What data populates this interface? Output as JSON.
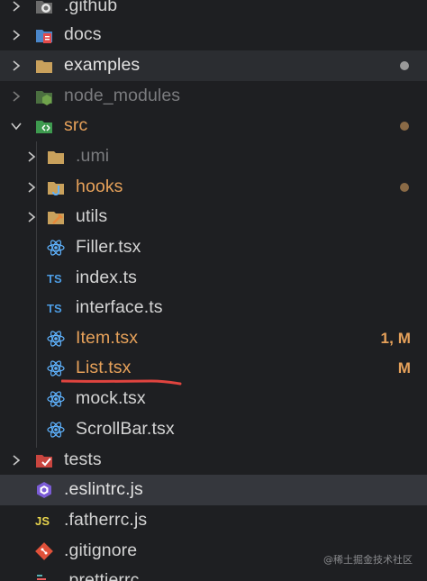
{
  "explorer": {
    "items": [
      {
        "label": ".github",
        "icon": "github-folder-icon",
        "color": "#d4d4d4"
      },
      {
        "label": "docs",
        "icon": "docs-folder-icon",
        "color": "#d4d4d4"
      },
      {
        "label": "examples",
        "icon": "folder-icon",
        "color": "#e2e2e2"
      },
      {
        "label": "node_modules",
        "icon": "node-folder-icon",
        "color": "#7a7b7e"
      },
      {
        "label": "src",
        "icon": "src-folder-icon",
        "color": "#e6a15a"
      },
      {
        "label": ".umi",
        "icon": "folder-icon",
        "color": "#7a7b7e"
      },
      {
        "label": "hooks",
        "icon": "hooks-folder-icon",
        "color": "#e6a15a"
      },
      {
        "label": "utils",
        "icon": "utils-folder-icon",
        "color": "#d4d4d4"
      },
      {
        "label": "Filler.tsx",
        "icon": "react-icon",
        "color": "#d4d4d4"
      },
      {
        "label": "index.ts",
        "icon": "typescript-icon",
        "color": "#d4d4d4"
      },
      {
        "label": "interface.ts",
        "icon": "typescript-icon",
        "color": "#d4d4d4"
      },
      {
        "label": "Item.tsx",
        "icon": "react-icon",
        "color": "#e6a15a"
      },
      {
        "label": "List.tsx",
        "icon": "react-icon",
        "color": "#e6a15a"
      },
      {
        "label": "mock.tsx",
        "icon": "react-icon",
        "color": "#d4d4d4"
      },
      {
        "label": "ScrollBar.tsx",
        "icon": "react-icon",
        "color": "#d4d4d4"
      },
      {
        "label": "tests",
        "icon": "tests-folder-icon",
        "color": "#d4d4d4"
      },
      {
        "label": ".eslintrc.js",
        "icon": "eslint-icon",
        "color": "#e2e2e2"
      },
      {
        "label": ".fatherrc.js",
        "icon": "javascript-icon",
        "color": "#d4d4d4"
      },
      {
        "label": ".gitignore",
        "icon": "git-icon",
        "color": "#d4d4d4"
      },
      {
        "label": ".prettierrc",
        "icon": "prettier-icon",
        "color": "#d4d4d4"
      }
    ],
    "status": {
      "item": "1, M",
      "list": "M"
    }
  },
  "watermark": "@稀土掘金技术社区",
  "colors": {
    "background": "#1e1f22",
    "highlight": "#2b2d31",
    "selected": "#35373d",
    "modified": "#e6a15a",
    "underline": "#e0443f",
    "react": "#5fb3ff",
    "typescript": "#4d9ee6",
    "javascript": "#e8d44d"
  }
}
